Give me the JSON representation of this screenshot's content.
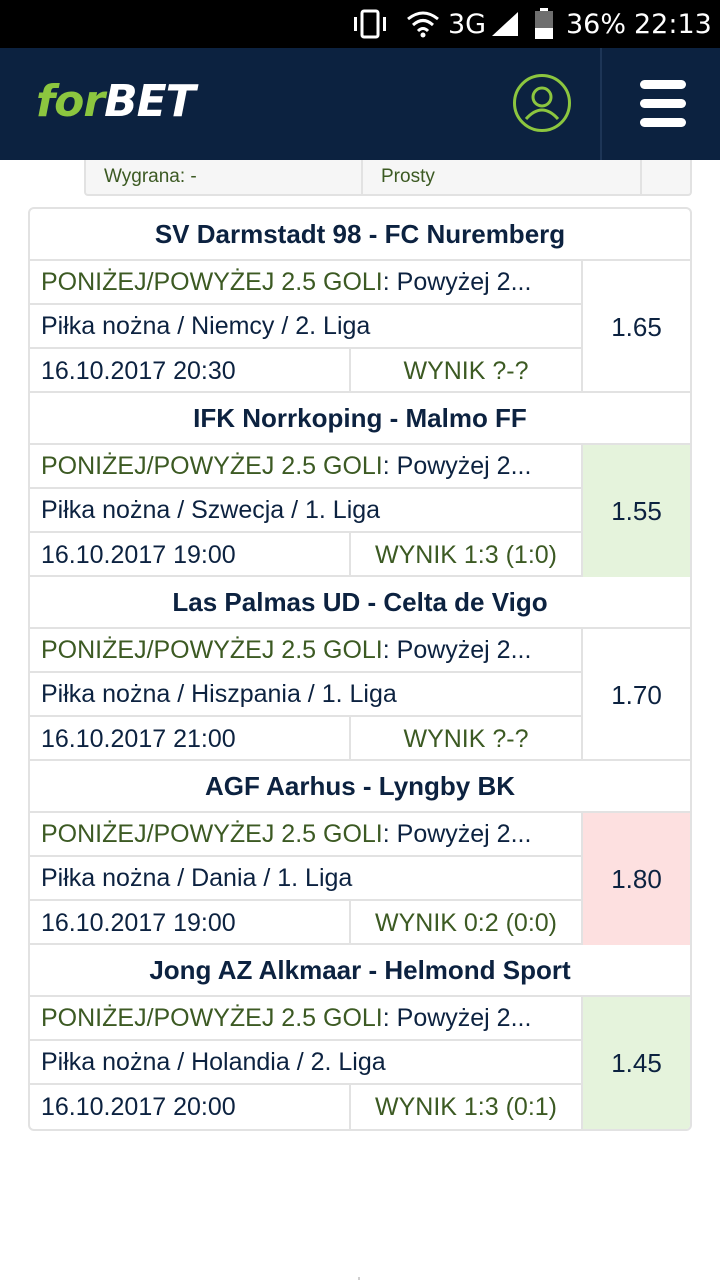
{
  "status_bar": {
    "signal": "3G",
    "battery": "36%",
    "time": "22:13"
  },
  "header": {
    "logo_for": "for",
    "logo_bet": "BET"
  },
  "prev_card": {
    "win_label": "Wygrana: -",
    "type_label": "Prosty"
  },
  "colors": {
    "header_bg": "#0c2240",
    "accent": "#8cc63f",
    "win_bg": "#e5f3dc",
    "lose_bg": "#fde0e0"
  },
  "matches": [
    {
      "title": "SV Darmstadt 98 - FC Nuremberg",
      "market_label": "PONIŻEJ/POWYŻEJ 2.5 GOLI",
      "market_sel": " : Powyżej 2...",
      "league": "Piłka nożna / Niemcy / 2. Liga",
      "datetime": "16.10.2017 20:30",
      "result": "WYNIK ?-?",
      "odds": "1.65",
      "status": "pending"
    },
    {
      "title": "IFK Norrkoping - Malmo FF",
      "market_label": "PONIŻEJ/POWYŻEJ 2.5 GOLI",
      "market_sel": " : Powyżej 2...",
      "league": "Piłka nożna / Szwecja / 1. Liga",
      "datetime": "16.10.2017 19:00",
      "result": "WYNIK 1:3 (1:0)",
      "odds": "1.55",
      "status": "win"
    },
    {
      "title": "Las Palmas UD - Celta de Vigo",
      "market_label": "PONIŻEJ/POWYŻEJ 2.5 GOLI",
      "market_sel": " : Powyżej 2...",
      "league": "Piłka nożna / Hiszpania / 1. Liga",
      "datetime": "16.10.2017 21:00",
      "result": "WYNIK ?-?",
      "odds": "1.70",
      "status": "pending"
    },
    {
      "title": "AGF Aarhus - Lyngby BK",
      "market_label": "PONIŻEJ/POWYŻEJ 2.5 GOLI",
      "market_sel": " : Powyżej 2...",
      "league": "Piłka nożna / Dania / 1. Liga",
      "datetime": "16.10.2017 19:00",
      "result": "WYNIK 0:2 (0:0)",
      "odds": "1.80",
      "status": "lose"
    },
    {
      "title": "Jong AZ Alkmaar - Helmond Sport",
      "market_label": "PONIŻEJ/POWYŻEJ 2.5 GOLI",
      "market_sel": " : Powyżej 2...",
      "league": "Piłka nożna / Holandia / 2. Liga",
      "datetime": "16.10.2017 20:00",
      "result": "WYNIK 1:3 (0:1)",
      "odds": "1.45",
      "status": "win"
    }
  ]
}
